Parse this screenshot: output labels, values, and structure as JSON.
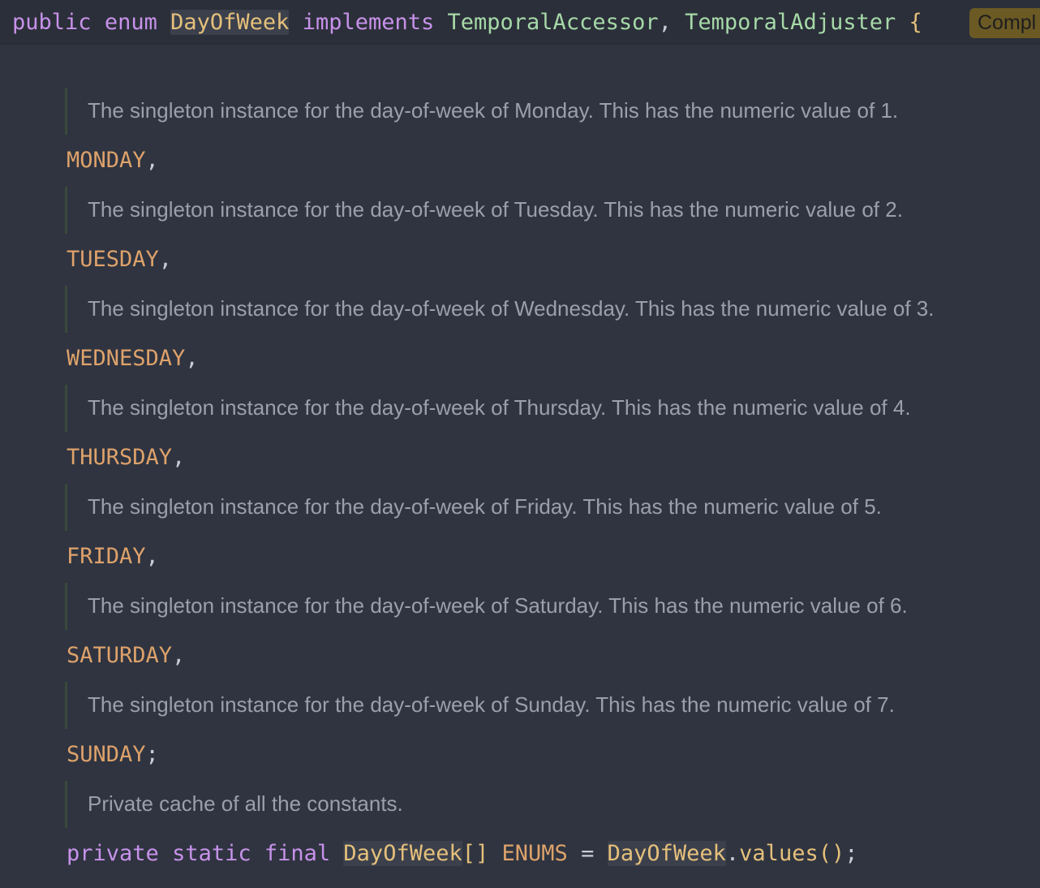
{
  "header": {
    "kw_public": "public",
    "kw_enum": "enum",
    "class_name": "DayOfWeek",
    "kw_implements": "implements",
    "iface1": "TemporalAccessor",
    "comma": ",",
    "iface2": "TemporalAdjuster",
    "brace": "{",
    "badge": "Compl"
  },
  "docs": [
    "The singleton instance for the day-of-week of Monday. This has the numeric value of 1.",
    "The singleton instance for the day-of-week of Tuesday. This has the numeric value of 2.",
    "The singleton instance for the day-of-week of Wednesday. This has the numeric value of 3.",
    "The singleton instance for the day-of-week of Thursday. This has the numeric value of 4.",
    "The singleton instance for the day-of-week of Friday. This has the numeric value of 5.",
    "The singleton instance for the day-of-week of Saturday. This has the numeric value of 6.",
    "The singleton instance for the day-of-week of Sunday. This has the numeric value of 7.",
    "Private cache of all the constants."
  ],
  "constants": [
    {
      "name": "MONDAY",
      "sep": ","
    },
    {
      "name": "TUESDAY",
      "sep": ","
    },
    {
      "name": "WEDNESDAY",
      "sep": ","
    },
    {
      "name": "THURSDAY",
      "sep": ","
    },
    {
      "name": "FRIDAY",
      "sep": ","
    },
    {
      "name": "SATURDAY",
      "sep": ","
    },
    {
      "name": "SUNDAY",
      "sep": ";"
    }
  ],
  "field": {
    "kw_private": "private",
    "kw_static": "static",
    "kw_final": "final",
    "type": "DayOfWeek",
    "array": "[]",
    "name": "ENUMS",
    "eq": "=",
    "owner": "DayOfWeek",
    "dot": ".",
    "method": "values",
    "parens": "()",
    "semi": ";"
  }
}
